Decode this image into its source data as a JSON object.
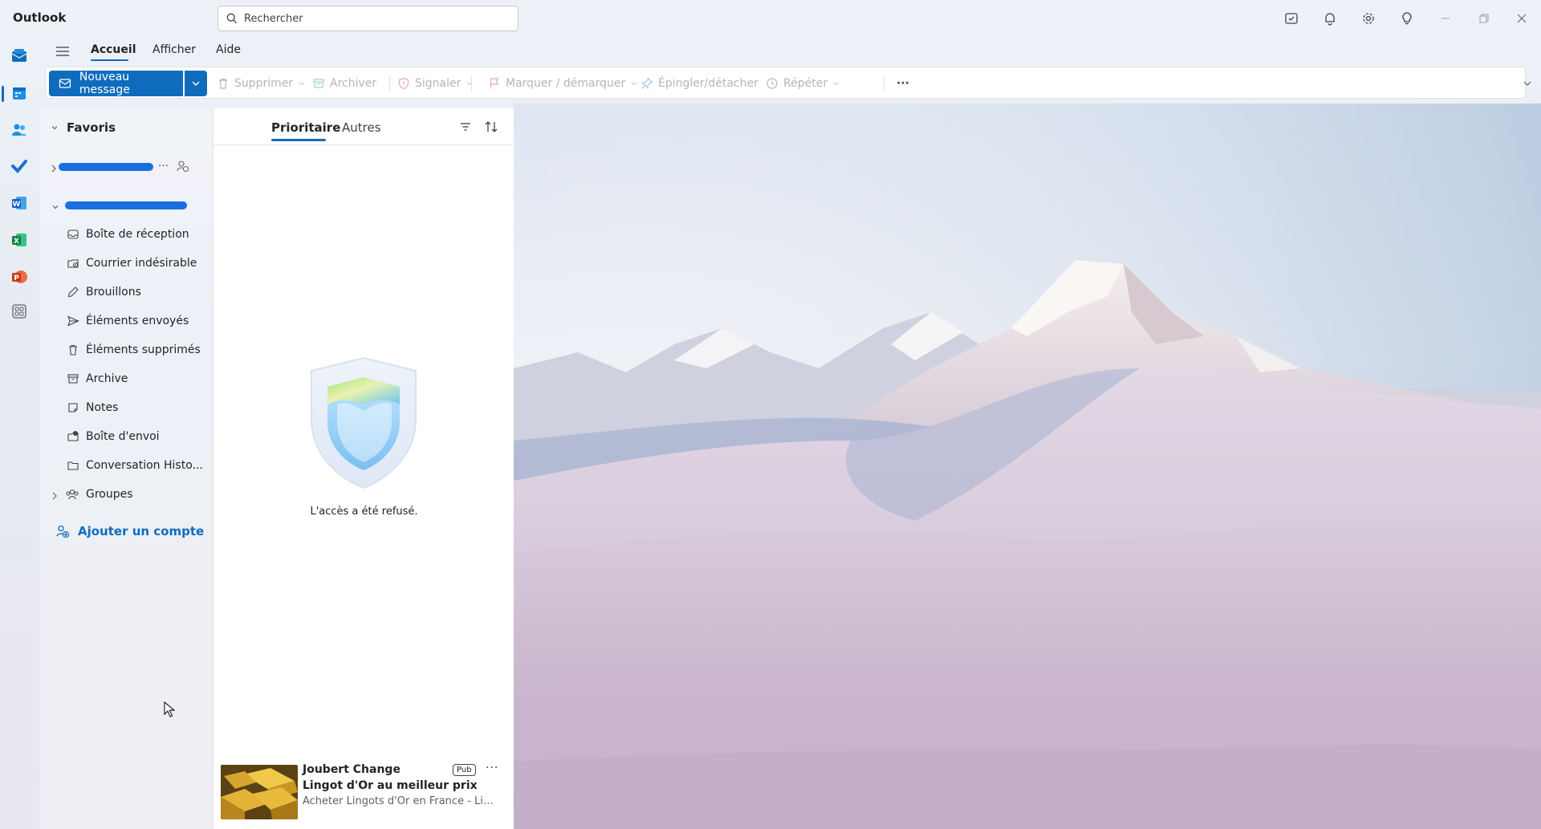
{
  "app": {
    "title": "Outlook"
  },
  "search": {
    "placeholder": "Rechercher"
  },
  "titlebar_icons": [
    "my-day-icon",
    "bell-icon",
    "gear-icon",
    "lightbulb-icon",
    "minimize-icon",
    "restore-icon",
    "close-icon"
  ],
  "rail": {
    "items": [
      "mail-icon",
      "calendar-icon",
      "people-icon",
      "todo-icon",
      "word-icon",
      "excel-icon",
      "powerpoint-icon",
      "apps-icon"
    ]
  },
  "menu": {
    "tabs": [
      {
        "label": "Accueil",
        "active": true
      },
      {
        "label": "Afficher",
        "active": false
      },
      {
        "label": "Aide",
        "active": false
      }
    ]
  },
  "toolbar": {
    "new_message": "Nouveau message",
    "delete": "Supprimer",
    "archive": "Archiver",
    "report": "Signaler",
    "flag": "Marquer / démarquer",
    "pin": "Épingler/détacher",
    "snooze": "Répéter",
    "more": "···"
  },
  "folders": {
    "favorites": "Favoris",
    "items": [
      {
        "label": "Boîte de réception",
        "icon": "inbox-icon"
      },
      {
        "label": "Courrier indésirable",
        "icon": "junk-icon"
      },
      {
        "label": "Brouillons",
        "icon": "drafts-icon"
      },
      {
        "label": "Éléments envoyés",
        "icon": "sent-icon"
      },
      {
        "label": "Éléments supprimés",
        "icon": "trash-icon"
      },
      {
        "label": "Archive",
        "icon": "archive-icon"
      },
      {
        "label": "Notes",
        "icon": "notes-icon"
      },
      {
        "label": "Boîte d'envoi",
        "icon": "outbox-icon"
      },
      {
        "label": "Conversation Histo...",
        "icon": "folder-icon"
      }
    ],
    "groups": "Groupes",
    "add_account": "Ajouter un compte"
  },
  "message_list": {
    "tabs": [
      {
        "label": "Prioritaire",
        "active": true
      },
      {
        "label": "Autres",
        "active": false
      }
    ],
    "empty_state": "L'accès a été refusé.",
    "ad": {
      "sender": "Joubert Change",
      "badge": "Pub",
      "more": "···",
      "subject": "Lingot d'Or au meilleur prix",
      "preview": "Acheter Lingots d'Or en France - Lingots d'Or"
    }
  },
  "colors": {
    "accent": "#0f6cbd"
  }
}
